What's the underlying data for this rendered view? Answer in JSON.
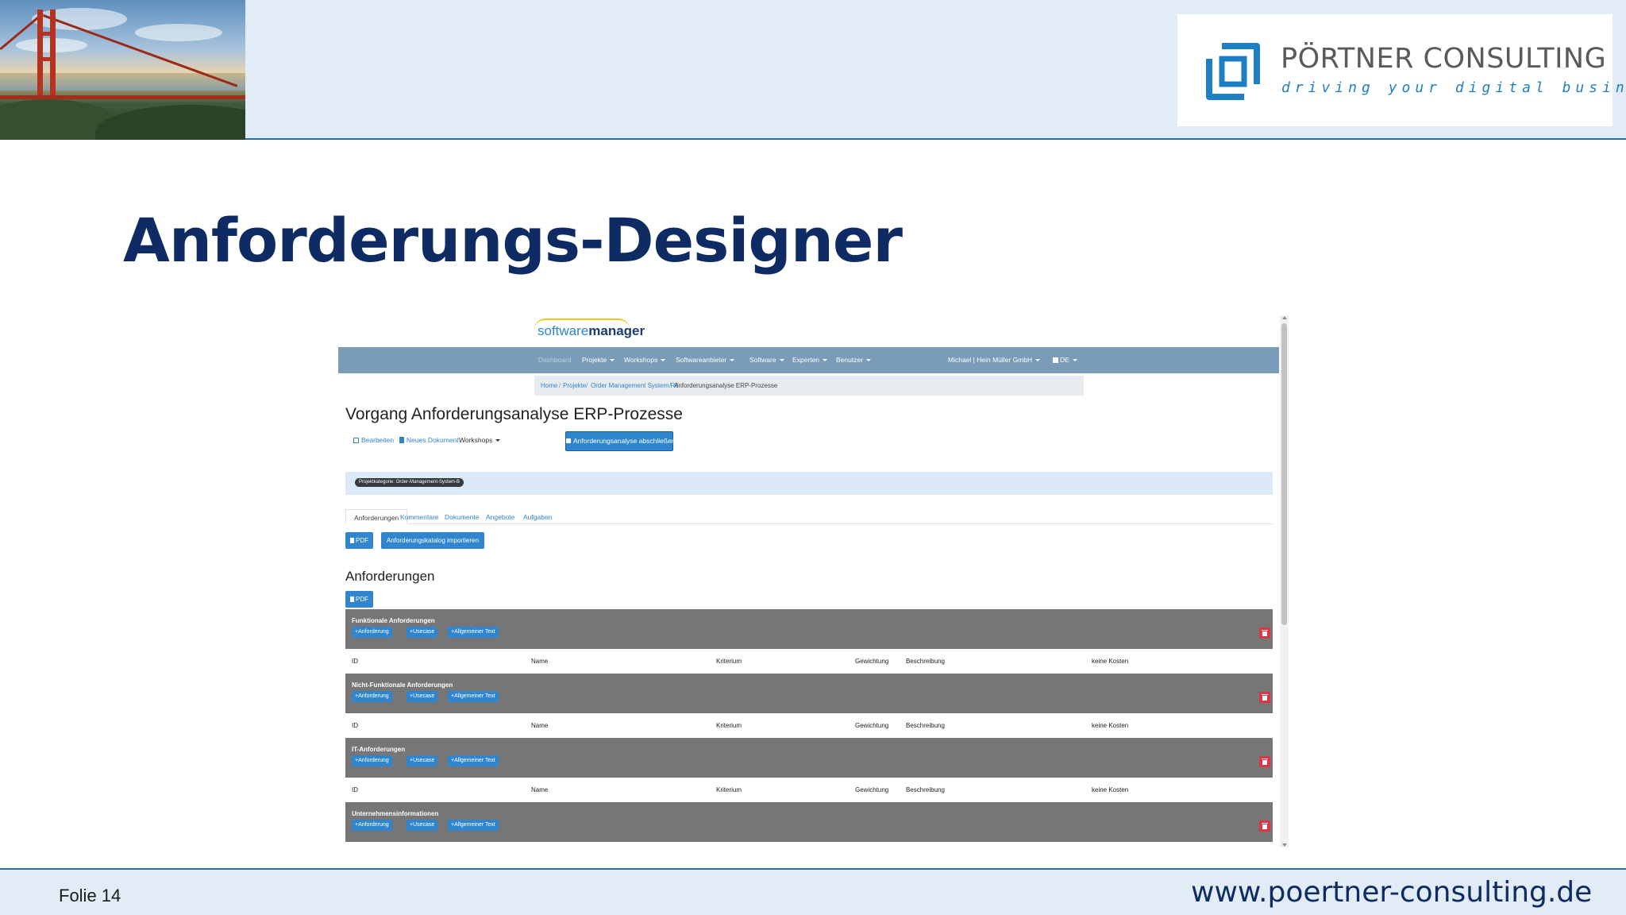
{
  "slide": {
    "title": "Anforderungs-Designer",
    "logo_name": "PÖRTNER CONSULTING",
    "logo_tagline": "driving your digital business",
    "footer_slide": "Folie 14",
    "footer_url": "www.poertner-consulting.de",
    "colors": {
      "header_bg": "#e1ecf6",
      "title": "#0f2b63",
      "accent": "#2e6ea6",
      "logo_blue": "#1f7fc4"
    }
  },
  "app": {
    "logo_part1": "software",
    "logo_part2": "manager",
    "nav": {
      "dashboard": "Dashboard",
      "projekte": "Projekte",
      "workshops": "Workshops",
      "softwareanbieter": "Softwareanbieter",
      "software": "Software",
      "experten": "Experten",
      "benutzer": "Benutzer",
      "user": "Michael | Hein Müller GmbH",
      "language": "DE"
    },
    "breadcrumb": {
      "home": "Home",
      "projekte": "Projekte",
      "project": "Order Management System Rtl",
      "current": "Anforderungsanalyse ERP-Prozesse",
      "separator": "/"
    },
    "heading": "Vorgang Anforderungsanalyse ERP-Prozesse",
    "actions": {
      "edit": "Bearbeiten",
      "new_doc": "Neues Dokument",
      "workshops": "Workshops",
      "finish": "Anforderungsanalyse abschließen"
    },
    "category_badge": "Projektkategorie: Order-Management-System-B",
    "tabs": [
      "Anforderungen",
      "Kommentare",
      "Dokumente",
      "Angebote",
      "Aufgaben"
    ],
    "buttons": {
      "pdf": "PDF",
      "import": "Anforderungskatalog importieren",
      "pdf2": "PDF"
    },
    "section_heading": "Anforderungen",
    "group_buttons": {
      "req": "Anforderung",
      "usecase": "Usecase",
      "text": "Allgemeiner Text"
    },
    "columns": {
      "id": "ID",
      "name": "Name",
      "kriterium": "Kriterium",
      "gewichtung": "Gewichtung",
      "beschreibung": "Beschreibung",
      "kosten": "keine Kosten"
    },
    "groups": [
      {
        "title": "Funktionale Anforderungen"
      },
      {
        "title": "Nicht-Funktionale Anforderungen"
      },
      {
        "title": "IT-Anforderungen"
      },
      {
        "title": "Unternehmensinformationen"
      }
    ],
    "colors": {
      "nav_bg": "#7a9cb8",
      "primary": "#2f86cf",
      "group_bg": "#767676",
      "danger": "#dc3545"
    }
  }
}
